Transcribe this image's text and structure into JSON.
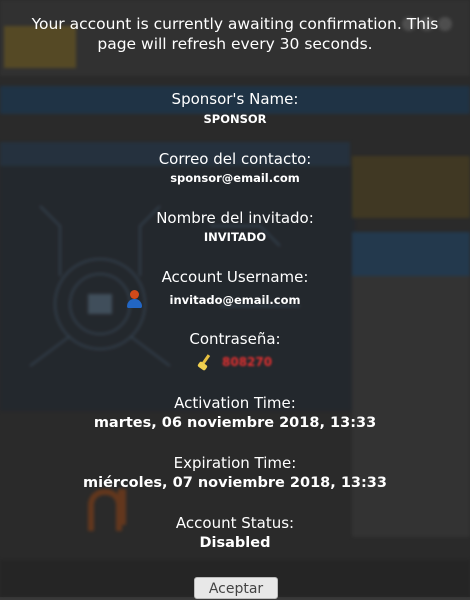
{
  "message": "Your account is currently awaiting confirmation. This page will refresh every 30 seconds.",
  "fields": {
    "sponsor_name": {
      "label": "Sponsor's Name:",
      "value": "SPONSOR"
    },
    "contact_email": {
      "label": "Correo del contacto:",
      "value": "sponsor@email.com"
    },
    "guest_name": {
      "label": "Nombre del invitado:",
      "value": "INVITADO"
    },
    "account_username": {
      "label": "Account Username:",
      "value": "invitado@email.com"
    },
    "password": {
      "label": "Contraseña:",
      "value": "808270"
    },
    "activation_time": {
      "label": "Activation Time:",
      "value": "martes, 06 noviembre 2018, 13:33"
    },
    "expiration_time": {
      "label": "Expiration Time:",
      "value": "miércoles, 07 noviembre 2018, 13:33"
    },
    "account_status": {
      "label": "Account Status:",
      "value": "Disabled"
    }
  },
  "accept_label": "Aceptar",
  "icons": {
    "user": "user-icon",
    "password": "broom-icon"
  },
  "colors": {
    "password_value": "#e03030",
    "overlay_text": "#ffffff"
  }
}
